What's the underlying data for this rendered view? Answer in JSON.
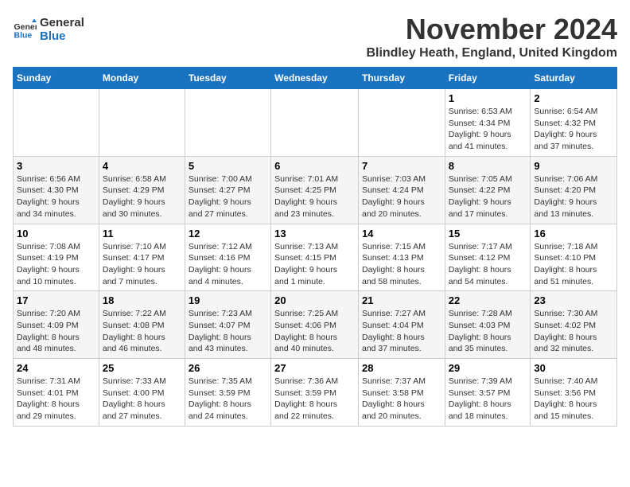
{
  "logo": {
    "text_general": "General",
    "text_blue": "Blue"
  },
  "title": "November 2024",
  "location": "Blindley Heath, England, United Kingdom",
  "headers": [
    "Sunday",
    "Monday",
    "Tuesday",
    "Wednesday",
    "Thursday",
    "Friday",
    "Saturday"
  ],
  "weeks": [
    [
      {
        "day": "",
        "info": ""
      },
      {
        "day": "",
        "info": ""
      },
      {
        "day": "",
        "info": ""
      },
      {
        "day": "",
        "info": ""
      },
      {
        "day": "",
        "info": ""
      },
      {
        "day": "1",
        "info": "Sunrise: 6:53 AM\nSunset: 4:34 PM\nDaylight: 9 hours\nand 41 minutes."
      },
      {
        "day": "2",
        "info": "Sunrise: 6:54 AM\nSunset: 4:32 PM\nDaylight: 9 hours\nand 37 minutes."
      }
    ],
    [
      {
        "day": "3",
        "info": "Sunrise: 6:56 AM\nSunset: 4:30 PM\nDaylight: 9 hours\nand 34 minutes."
      },
      {
        "day": "4",
        "info": "Sunrise: 6:58 AM\nSunset: 4:29 PM\nDaylight: 9 hours\nand 30 minutes."
      },
      {
        "day": "5",
        "info": "Sunrise: 7:00 AM\nSunset: 4:27 PM\nDaylight: 9 hours\nand 27 minutes."
      },
      {
        "day": "6",
        "info": "Sunrise: 7:01 AM\nSunset: 4:25 PM\nDaylight: 9 hours\nand 23 minutes."
      },
      {
        "day": "7",
        "info": "Sunrise: 7:03 AM\nSunset: 4:24 PM\nDaylight: 9 hours\nand 20 minutes."
      },
      {
        "day": "8",
        "info": "Sunrise: 7:05 AM\nSunset: 4:22 PM\nDaylight: 9 hours\nand 17 minutes."
      },
      {
        "day": "9",
        "info": "Sunrise: 7:06 AM\nSunset: 4:20 PM\nDaylight: 9 hours\nand 13 minutes."
      }
    ],
    [
      {
        "day": "10",
        "info": "Sunrise: 7:08 AM\nSunset: 4:19 PM\nDaylight: 9 hours\nand 10 minutes."
      },
      {
        "day": "11",
        "info": "Sunrise: 7:10 AM\nSunset: 4:17 PM\nDaylight: 9 hours\nand 7 minutes."
      },
      {
        "day": "12",
        "info": "Sunrise: 7:12 AM\nSunset: 4:16 PM\nDaylight: 9 hours\nand 4 minutes."
      },
      {
        "day": "13",
        "info": "Sunrise: 7:13 AM\nSunset: 4:15 PM\nDaylight: 9 hours\nand 1 minute."
      },
      {
        "day": "14",
        "info": "Sunrise: 7:15 AM\nSunset: 4:13 PM\nDaylight: 8 hours\nand 58 minutes."
      },
      {
        "day": "15",
        "info": "Sunrise: 7:17 AM\nSunset: 4:12 PM\nDaylight: 8 hours\nand 54 minutes."
      },
      {
        "day": "16",
        "info": "Sunrise: 7:18 AM\nSunset: 4:10 PM\nDaylight: 8 hours\nand 51 minutes."
      }
    ],
    [
      {
        "day": "17",
        "info": "Sunrise: 7:20 AM\nSunset: 4:09 PM\nDaylight: 8 hours\nand 48 minutes."
      },
      {
        "day": "18",
        "info": "Sunrise: 7:22 AM\nSunset: 4:08 PM\nDaylight: 8 hours\nand 46 minutes."
      },
      {
        "day": "19",
        "info": "Sunrise: 7:23 AM\nSunset: 4:07 PM\nDaylight: 8 hours\nand 43 minutes."
      },
      {
        "day": "20",
        "info": "Sunrise: 7:25 AM\nSunset: 4:06 PM\nDaylight: 8 hours\nand 40 minutes."
      },
      {
        "day": "21",
        "info": "Sunrise: 7:27 AM\nSunset: 4:04 PM\nDaylight: 8 hours\nand 37 minutes."
      },
      {
        "day": "22",
        "info": "Sunrise: 7:28 AM\nSunset: 4:03 PM\nDaylight: 8 hours\nand 35 minutes."
      },
      {
        "day": "23",
        "info": "Sunrise: 7:30 AM\nSunset: 4:02 PM\nDaylight: 8 hours\nand 32 minutes."
      }
    ],
    [
      {
        "day": "24",
        "info": "Sunrise: 7:31 AM\nSunset: 4:01 PM\nDaylight: 8 hours\nand 29 minutes."
      },
      {
        "day": "25",
        "info": "Sunrise: 7:33 AM\nSunset: 4:00 PM\nDaylight: 8 hours\nand 27 minutes."
      },
      {
        "day": "26",
        "info": "Sunrise: 7:35 AM\nSunset: 3:59 PM\nDaylight: 8 hours\nand 24 minutes."
      },
      {
        "day": "27",
        "info": "Sunrise: 7:36 AM\nSunset: 3:59 PM\nDaylight: 8 hours\nand 22 minutes."
      },
      {
        "day": "28",
        "info": "Sunrise: 7:37 AM\nSunset: 3:58 PM\nDaylight: 8 hours\nand 20 minutes."
      },
      {
        "day": "29",
        "info": "Sunrise: 7:39 AM\nSunset: 3:57 PM\nDaylight: 8 hours\nand 18 minutes."
      },
      {
        "day": "30",
        "info": "Sunrise: 7:40 AM\nSunset: 3:56 PM\nDaylight: 8 hours\nand 15 minutes."
      }
    ]
  ]
}
